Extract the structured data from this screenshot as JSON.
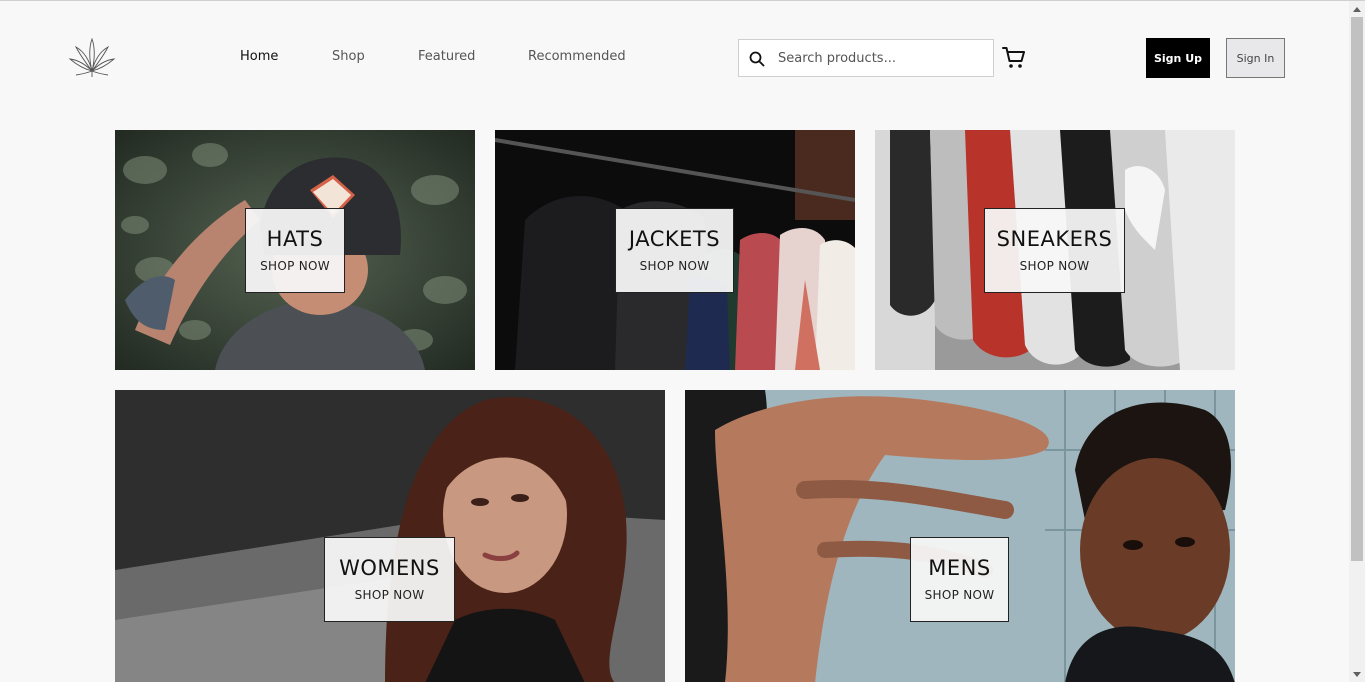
{
  "brand": {
    "logo_icon": "cannabis-leaf-icon"
  },
  "nav": [
    {
      "label": "Home",
      "active": true
    },
    {
      "label": "Shop",
      "active": false
    },
    {
      "label": "Featured",
      "active": false
    },
    {
      "label": "Recommended",
      "active": false
    }
  ],
  "search": {
    "placeholder": "Search products...",
    "value": "",
    "icon": "search-icon"
  },
  "cart": {
    "icon": "cart-icon"
  },
  "auth": {
    "signup_label": "Sign Up",
    "signin_label": "Sign In"
  },
  "categories": [
    {
      "title": "HATS",
      "cta": "SHOP NOW"
    },
    {
      "title": "JACKETS",
      "cta": "SHOP NOW"
    },
    {
      "title": "SNEAKERS",
      "cta": "SHOP NOW"
    },
    {
      "title": "WOMENS",
      "cta": "SHOP NOW"
    },
    {
      "title": "MENS",
      "cta": "SHOP NOW"
    }
  ],
  "colors": {
    "accent": "#000000",
    "background": "#f8f8f8"
  }
}
